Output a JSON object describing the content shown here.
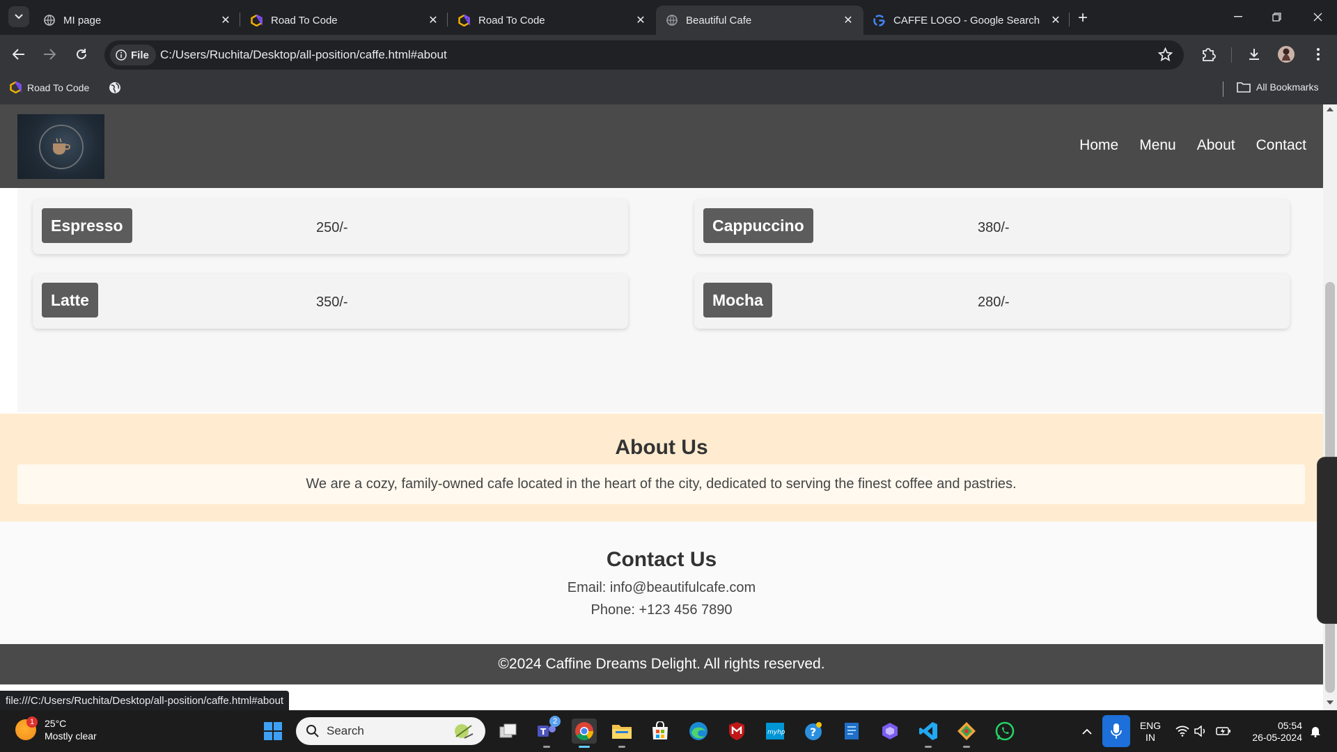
{
  "browser": {
    "tabs": [
      {
        "title": "MI page",
        "active": false
      },
      {
        "title": "Road To Code",
        "active": false
      },
      {
        "title": "Road To Code",
        "active": false
      },
      {
        "title": "Beautiful Cafe",
        "active": true
      },
      {
        "title": "CAFFE LOGO - Google Search",
        "active": false
      }
    ],
    "chip_label": "File",
    "url": "C:/Users/Ruchita/Desktop/all-position/caffe.html#about",
    "bookmarks": {
      "item1": "Road To Code",
      "all": "All Bookmarks"
    },
    "status_url": "file:///C:/Users/Ruchita/Desktop/all-position/caffe.html#about"
  },
  "site": {
    "nav": [
      "Home",
      "Menu",
      "About",
      "Contact"
    ],
    "menu_items": [
      {
        "name": "Espresso",
        "price": "250/-"
      },
      {
        "name": "Cappuccino",
        "price": "380/-"
      },
      {
        "name": "Latte",
        "price": "350/-"
      },
      {
        "name": "Mocha",
        "price": "280/-"
      }
    ],
    "about": {
      "heading": "About Us",
      "text": "We are a cozy, family-owned cafe located in the heart of the city, dedicated to serving the finest coffee and pastries."
    },
    "contact": {
      "heading": "Contact Us",
      "email": "Email: info@beautifulcafe.com",
      "phone": "Phone: +123 456 7890"
    },
    "footer": "©2024 Caffine Dreams Delight. All rights reserved."
  },
  "taskbar": {
    "weather_temp": "25°C",
    "weather_desc": "Mostly clear",
    "weather_badge": "1",
    "search_placeholder": "Search",
    "teams_badge": "2",
    "lang_1": "ENG",
    "lang_2": "IN",
    "time": "05:54",
    "date": "26-05-2024"
  },
  "colors": {
    "header": "#4a4a4a",
    "about_bg": "#ffecd0",
    "menu_label": "#5c5c5c",
    "taskbar_accent": "#60cdff"
  }
}
